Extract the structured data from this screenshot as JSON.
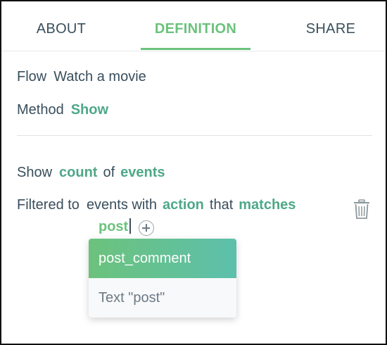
{
  "tabs": [
    {
      "label": "ABOUT",
      "active": false
    },
    {
      "label": "DEFINITION",
      "active": true
    },
    {
      "label": "SHARE",
      "active": false
    }
  ],
  "flow": {
    "label": "Flow",
    "value": "Watch a movie"
  },
  "method": {
    "label": "Method",
    "value": "Show"
  },
  "show": {
    "label": "Show",
    "measure": "count",
    "connector": "of",
    "subject": "events"
  },
  "filter": {
    "label": "Filtered to",
    "subject": "events with",
    "property": "action",
    "connector": "that",
    "operator": "matches",
    "typed_value": "post"
  },
  "dropdown": {
    "options": [
      "post_comment",
      "Text \"post\""
    ],
    "selected_index": 0
  },
  "icons": {
    "delete": "trash-icon",
    "add": "plus-circle-icon"
  },
  "colors": {
    "accent": "#6cc27c",
    "accent_teal": "#4ea888",
    "text": "#394e5c"
  }
}
